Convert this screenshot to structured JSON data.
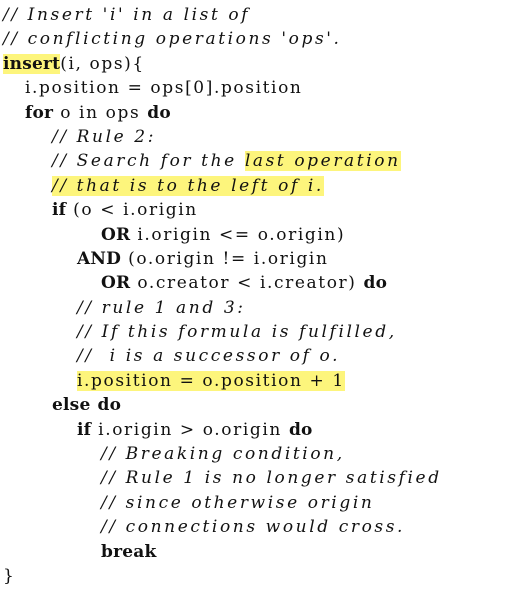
{
  "colors": {
    "text": "#111111",
    "highlight": "#fdf57c",
    "background": "#ffffff"
  },
  "lines": [
    {
      "indent": 0,
      "segments": [
        {
          "t": "// Insert 'i' in a list of",
          "s": "cm"
        }
      ]
    },
    {
      "indent": 0,
      "segments": [
        {
          "t": "// conflicting operations 'ops'.",
          "s": "cm"
        }
      ]
    },
    {
      "indent": 0,
      "segments": [
        {
          "t": "insert",
          "s": "kw",
          "hl": true
        },
        {
          "t": "(i, ops){",
          "s": "tx"
        }
      ]
    },
    {
      "indent": 1,
      "segments": [
        {
          "t": "i.position = ops[0].position",
          "s": "tx"
        }
      ]
    },
    {
      "indent": 1,
      "segments": [
        {
          "t": "for",
          "s": "kw"
        },
        {
          "t": " o in ops ",
          "s": "tx"
        },
        {
          "t": "do",
          "s": "kw"
        }
      ]
    },
    {
      "indent": 2,
      "segments": [
        {
          "t": "// Rule 2:",
          "s": "cm"
        }
      ]
    },
    {
      "indent": 2,
      "segments": [
        {
          "t": "// Search for the ",
          "s": "cm"
        },
        {
          "t": "last operation",
          "s": "cm",
          "hl": true
        }
      ]
    },
    {
      "indent": 2,
      "segments": [
        {
          "t": "// that is to the left of i.",
          "s": "cm",
          "hl": true
        }
      ]
    },
    {
      "indent": 2,
      "segments": [
        {
          "t": "if",
          "s": "kw"
        },
        {
          "t": " (o < i.origin",
          "s": "tx"
        }
      ]
    },
    {
      "indent": 4,
      "segments": [
        {
          "t": "OR",
          "s": "kw"
        },
        {
          "t": " i.origin <= o.origin)",
          "s": "tx"
        }
      ]
    },
    {
      "indent": 3,
      "segments": [
        {
          "t": "AND",
          "s": "kw"
        },
        {
          "t": " (o.origin != i.origin",
          "s": "tx"
        }
      ]
    },
    {
      "indent": 4,
      "segments": [
        {
          "t": "OR",
          "s": "kw"
        },
        {
          "t": " o.creator < i.creator) ",
          "s": "tx"
        },
        {
          "t": "do",
          "s": "kw"
        }
      ]
    },
    {
      "indent": 3,
      "segments": [
        {
          "t": "// rule 1 and 3:",
          "s": "cm"
        }
      ]
    },
    {
      "indent": 3,
      "segments": [
        {
          "t": "// If this formula is fulfilled,",
          "s": "cm"
        }
      ]
    },
    {
      "indent": 3,
      "segments": [
        {
          "t": "//  i is a successor of o.",
          "s": "cm"
        }
      ]
    },
    {
      "indent": 3,
      "segments": [
        {
          "t": "i.position = o.position + 1",
          "s": "tx",
          "hl": true
        }
      ]
    },
    {
      "indent": 2,
      "segments": [
        {
          "t": "else",
          "s": "kw"
        },
        {
          "t": " ",
          "s": "tx"
        },
        {
          "t": "do",
          "s": "kw"
        }
      ]
    },
    {
      "indent": 3,
      "segments": [
        {
          "t": "if",
          "s": "kw"
        },
        {
          "t": " i.origin > o.origin ",
          "s": "tx"
        },
        {
          "t": "do",
          "s": "kw"
        }
      ]
    },
    {
      "indent": 4,
      "segments": [
        {
          "t": "// Breaking condition,",
          "s": "cm"
        }
      ]
    },
    {
      "indent": 4,
      "segments": [
        {
          "t": "// Rule 1 is no longer satisfied",
          "s": "cm"
        }
      ]
    },
    {
      "indent": 4,
      "segments": [
        {
          "t": "// since otherwise origin",
          "s": "cm"
        }
      ]
    },
    {
      "indent": 4,
      "segments": [
        {
          "t": "// connections would cross.",
          "s": "cm"
        }
      ]
    },
    {
      "indent": 4,
      "segments": [
        {
          "t": "break",
          "s": "kw"
        }
      ]
    },
    {
      "indent": 0,
      "segments": [
        {
          "t": "}",
          "s": "tx"
        }
      ]
    }
  ]
}
